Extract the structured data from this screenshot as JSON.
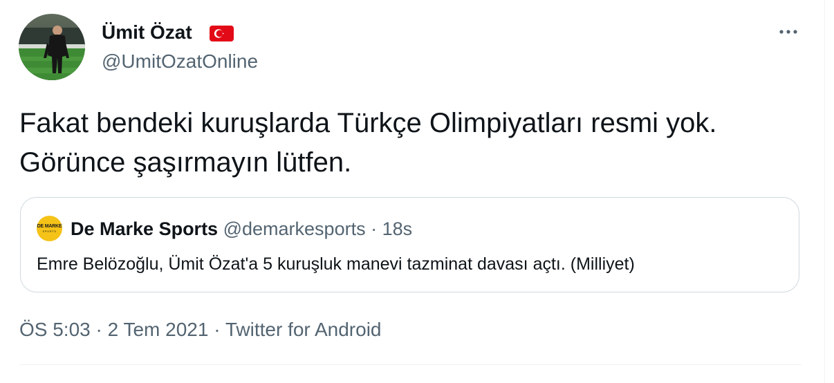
{
  "author": {
    "display_name": "Ümit Özat",
    "handle": "@UmitOzatOnline",
    "avatar_icon": "profile-photo",
    "flag_icon": "turkey-flag-icon"
  },
  "tweet": {
    "lines": [
      "Fakat bendeki kuruşlarda Türkçe Olimpiyatları resmi yok.",
      "Görünce şaşırmayın lütfen."
    ]
  },
  "quoted": {
    "display_name": "De Marke Sports",
    "handle": "@demarkesports",
    "separator": "·",
    "time": "18s",
    "text": "Emre Belözoğlu, Ümit Özat'a 5 kuruşluk manevi tazminat davası açtı. (Milliyet)",
    "avatar_logo": "DE MARKE",
    "avatar_logo_sub": "SPORTS",
    "avatar_color": "#f5c318"
  },
  "meta": {
    "time": "ÖS 5:03",
    "date": "2 Tem 2021",
    "source": "Twitter for Android",
    "separator": "·"
  },
  "colors": {
    "text": "#0f1419",
    "secondary": "#536471",
    "border": "#cfd9de",
    "flag_red": "#e30a17"
  }
}
